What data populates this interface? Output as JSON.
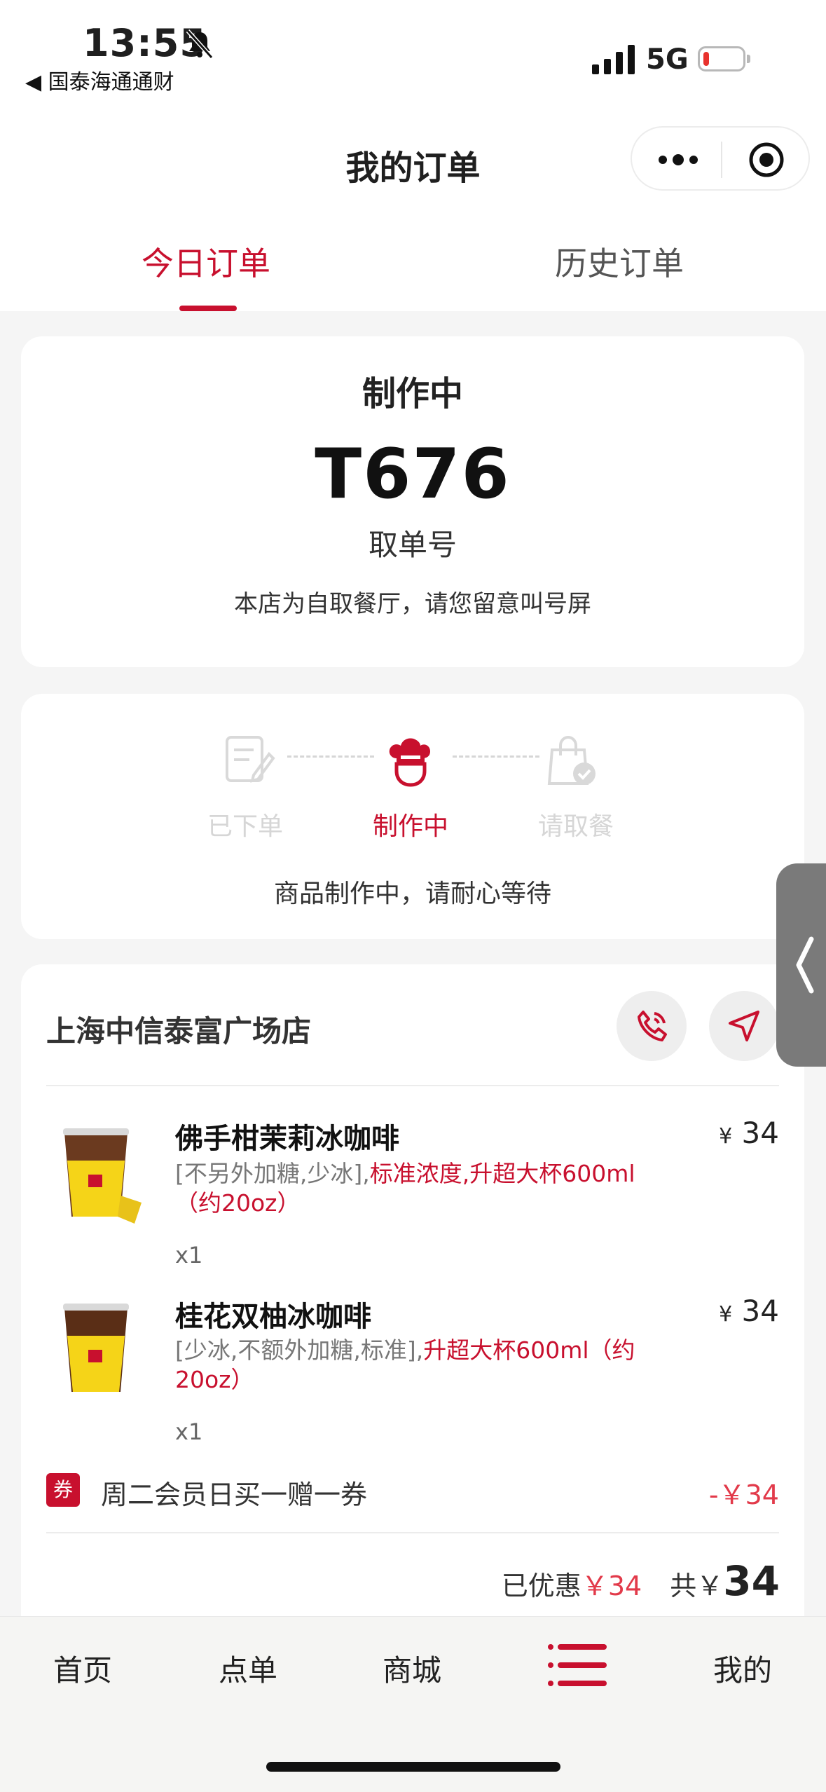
{
  "status_bar": {
    "time": "13:55",
    "back_app": "◀ 国泰海通通财",
    "network": "5G"
  },
  "header": {
    "title": "我的订单",
    "tabs": [
      {
        "label": "今日订单",
        "active": true
      },
      {
        "label": "历史订单",
        "active": false
      }
    ]
  },
  "order_status": {
    "title": "制作中",
    "pickup_number": "T676",
    "pickup_label": "取单号",
    "notice": "本店为自取餐厅，请您留意叫号屏"
  },
  "progress": {
    "steps": [
      {
        "label": "已下单",
        "state": "done"
      },
      {
        "label": "制作中",
        "state": "current"
      },
      {
        "label": "请取餐",
        "state": "pending"
      }
    ],
    "message": "商品制作中，请耐心等待"
  },
  "store": {
    "name": "上海中信泰富广场店"
  },
  "items": [
    {
      "name": "佛手柑茉莉冰咖啡",
      "options_plain": "[不另外加糖,少冰],",
      "options_highlight": "标准浓度,升超大杯600ml（约20oz）",
      "qty": "x1",
      "currency": "¥",
      "price": "34"
    },
    {
      "name": "桂花双柚冰咖啡",
      "options_plain": "[少冰,不额外加糖,标准],",
      "options_highlight": "升超大杯600ml（约20oz）",
      "qty": "x1",
      "currency": "¥",
      "price": "34"
    }
  ],
  "coupon": {
    "badge": "券",
    "text": "周二会员日买一赠一券",
    "value": "-￥34"
  },
  "totals": {
    "discount_label": "已优惠",
    "discount_value": "￥34",
    "total_label": "共￥",
    "total_value": "34"
  },
  "tabbar": {
    "items": [
      "首页",
      "点单",
      "商城",
      "",
      "我的"
    ]
  },
  "colors": {
    "accent": "#c8102e",
    "price_red": "#e23a4a"
  }
}
